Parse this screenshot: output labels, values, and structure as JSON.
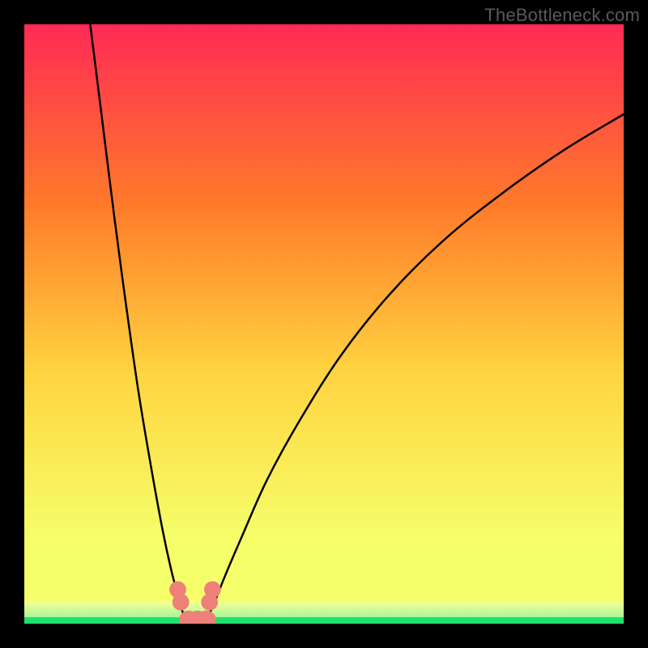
{
  "watermark": "TheBottleneck.com",
  "chart_data": {
    "type": "line",
    "title": "",
    "xlabel": "",
    "ylabel": "",
    "xlim": [
      0,
      100
    ],
    "ylim": [
      0,
      100
    ],
    "grid": false,
    "legend": false,
    "background_gradient": {
      "top": "#ff2a55",
      "mid1": "#ff7a2a",
      "mid2": "#ffd440",
      "mid3": "#f5ff6a",
      "bottom": "#1fe06f"
    },
    "series": [
      {
        "name": "left-branch",
        "x": [
          11,
          13,
          15,
          17,
          19,
          21,
          23,
          24.5,
          25.7,
          26.4,
          27.0
        ],
        "y": [
          100,
          84,
          68,
          53,
          39,
          27,
          16,
          9,
          4.5,
          2,
          0.4
        ]
      },
      {
        "name": "right-branch",
        "x": [
          30.2,
          31.5,
          33.5,
          36.5,
          40.5,
          46,
          53,
          61,
          70,
          80,
          90,
          100
        ],
        "y": [
          0.4,
          3,
          8,
          15,
          24,
          34,
          45,
          55,
          64,
          72,
          79,
          85
        ]
      }
    ],
    "markers": [
      {
        "name": "left-dot-upper",
        "x": 25.6,
        "y": 5.7,
        "r": 1.4
      },
      {
        "name": "left-dot-lower",
        "x": 26.1,
        "y": 3.6,
        "r": 1.4
      },
      {
        "name": "right-dot-upper",
        "x": 31.4,
        "y": 5.7,
        "r": 1.4
      },
      {
        "name": "right-dot-lower",
        "x": 30.9,
        "y": 3.6,
        "r": 1.4
      },
      {
        "name": "bottom-blob-1",
        "x": 27.4,
        "y": 0.6,
        "r": 1.6
      },
      {
        "name": "bottom-blob-2",
        "x": 28.9,
        "y": 0.6,
        "r": 1.6
      },
      {
        "name": "bottom-blob-3",
        "x": 30.4,
        "y": 0.6,
        "r": 1.6
      }
    ],
    "marker_color": "#ed8079",
    "curve_color": "#000000",
    "curve_width": 2.5
  }
}
